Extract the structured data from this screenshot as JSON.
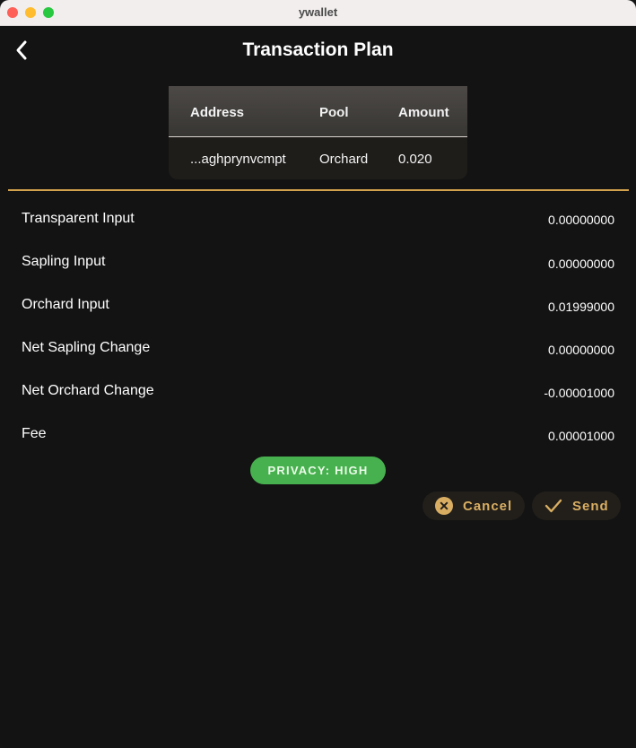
{
  "window": {
    "title": "ywallet"
  },
  "header": {
    "title": "Transaction Plan",
    "back_icon": "chevron-left-icon"
  },
  "recipients_table": {
    "columns": [
      "Address",
      "Pool",
      "Amount"
    ],
    "rows": [
      {
        "address": "...aghprynvcmpt",
        "pool": "Orchard",
        "amount": "0.020"
      }
    ]
  },
  "summary": [
    {
      "label": "Transparent Input",
      "value": "0.00000000"
    },
    {
      "label": "Sapling Input",
      "value": "0.00000000"
    },
    {
      "label": "Orchard Input",
      "value": "0.01999000"
    },
    {
      "label": "Net Sapling Change",
      "value": "0.00000000"
    },
    {
      "label": "Net Orchard Change",
      "value": "-0.00001000"
    },
    {
      "label": "Fee",
      "value": "0.00001000"
    }
  ],
  "privacy": {
    "label": "PRIVACY: HIGH",
    "color": "#48b14f"
  },
  "actions": {
    "cancel_label": "Cancel",
    "cancel_icon": "cancel-circle-icon",
    "send_label": "Send",
    "send_icon": "checkmark-icon"
  },
  "colors": {
    "accent": "#d3a24c",
    "background": "#131313"
  }
}
